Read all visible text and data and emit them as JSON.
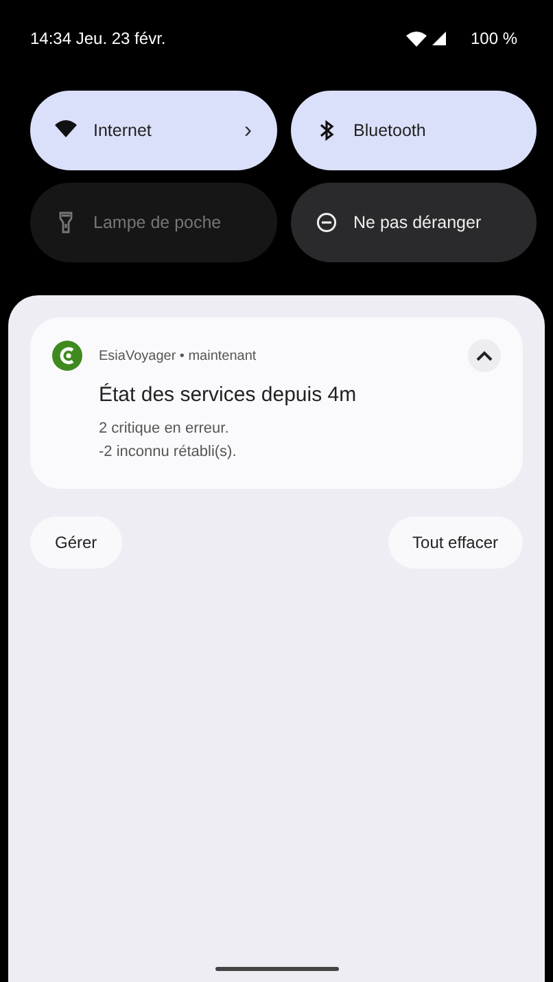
{
  "status_bar": {
    "time": "14:34 Jeu. 23 févr.",
    "battery": "100 %"
  },
  "tiles": [
    {
      "kind": "wifi",
      "label": "Internet",
      "on": true,
      "chevron": "›"
    },
    {
      "kind": "bluetooth",
      "label": "Bluetooth",
      "on": true
    },
    {
      "kind": "flashlight",
      "label": "Lampe de poche",
      "on": false,
      "disabled": true
    },
    {
      "kind": "dnd",
      "label": "Ne pas déranger",
      "on": false,
      "disabled": false
    }
  ],
  "notification": {
    "app": "EsiaVoyager • maintenant",
    "expanded": true,
    "title": "État des services depuis 4m",
    "lines": [
      "2 critique en erreur.",
      "-2 inconnu rétabli(s)."
    ]
  },
  "buttons": [
    "Gérer",
    "Tout effacer"
  ]
}
